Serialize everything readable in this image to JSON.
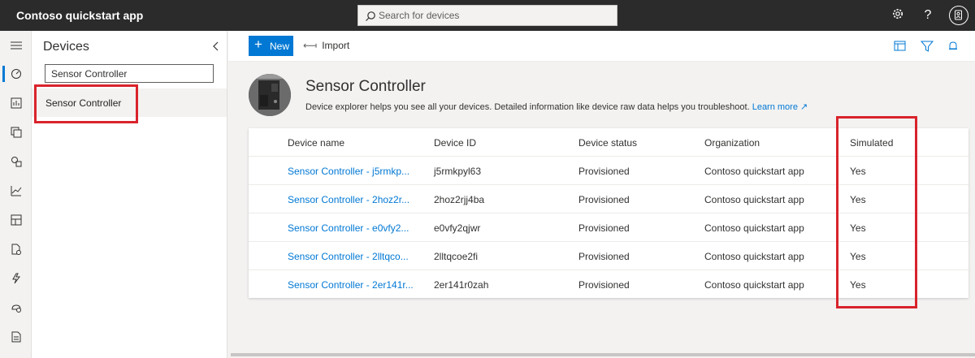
{
  "app": {
    "title": "Contoso quickstart app"
  },
  "search": {
    "placeholder": "Search for devices"
  },
  "topbar_icons": [
    "settings-icon",
    "help-icon",
    "account-icon"
  ],
  "rail": {
    "items": [
      "menu-icon",
      "dashboard-icon",
      "analytics-icon",
      "devices-icon",
      "device-groups-icon",
      "charts-icon",
      "device-templates-icon",
      "data-export-icon",
      "rules-icon",
      "jobs-icon",
      "reports-icon"
    ]
  },
  "devices_panel": {
    "title": "Devices",
    "filter_value": "Sensor Controller",
    "items": [
      {
        "label": "Sensor Controller"
      }
    ]
  },
  "command_bar": {
    "new_label": "New",
    "import_label": "Import"
  },
  "header": {
    "title": "Sensor Controller",
    "description": "Device explorer helps you see all your devices. Detailed information like device raw data helps you troubleshoot.",
    "learn_more": "Learn more"
  },
  "table": {
    "columns": [
      "Device name",
      "Device ID",
      "Device status",
      "Organization",
      "Simulated"
    ],
    "rows": [
      {
        "name": "Sensor Controller - j5rmkp...",
        "id": "j5rmkpyl63",
        "status": "Provisioned",
        "org": "Contoso quickstart app",
        "simulated": "Yes"
      },
      {
        "name": "Sensor Controller - 2hoz2r...",
        "id": "2hoz2rjj4ba",
        "status": "Provisioned",
        "org": "Contoso quickstart app",
        "simulated": "Yes"
      },
      {
        "name": "Sensor Controller - e0vfy2...",
        "id": "e0vfy2qjwr",
        "status": "Provisioned",
        "org": "Contoso quickstart app",
        "simulated": "Yes"
      },
      {
        "name": "Sensor Controller - 2lltqco...",
        "id": "2lltqcoe2fi",
        "status": "Provisioned",
        "org": "Contoso quickstart app",
        "simulated": "Yes"
      },
      {
        "name": "Sensor Controller - 2er141r...",
        "id": "2er141r0zah",
        "status": "Provisioned",
        "org": "Contoso quickstart app",
        "simulated": "Yes"
      }
    ]
  },
  "colors": {
    "accent": "#0078d4",
    "topbar": "#2b2b2b",
    "highlight": "#d9232b"
  }
}
